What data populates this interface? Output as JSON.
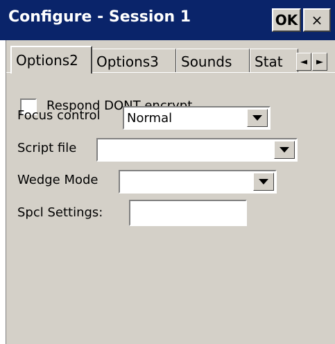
{
  "window": {
    "title": "Configure - Session 1",
    "ok_label": "OK",
    "close_label": "×"
  },
  "tabs": [
    {
      "label": "Options2",
      "active": true
    },
    {
      "label": "Options3",
      "active": false
    },
    {
      "label": "Sounds",
      "active": false
    },
    {
      "label": "Stat",
      "active": false
    }
  ],
  "tab_scroll": {
    "left_icon": "◄",
    "right_icon": "►"
  },
  "form": {
    "respond_dont_encrypt": {
      "label": "Respond DONT encrypt",
      "checked": false
    },
    "focus_control": {
      "label": "Focus control",
      "value": "Normal"
    },
    "script_file": {
      "label": "Script file",
      "value": ""
    },
    "wedge_mode": {
      "label": "Wedge Mode",
      "value": ""
    },
    "spcl_settings": {
      "label": "Spcl Settings:",
      "value": ""
    }
  },
  "colors": {
    "titlebar": "#0a246a",
    "face": "#d4d0c8"
  }
}
